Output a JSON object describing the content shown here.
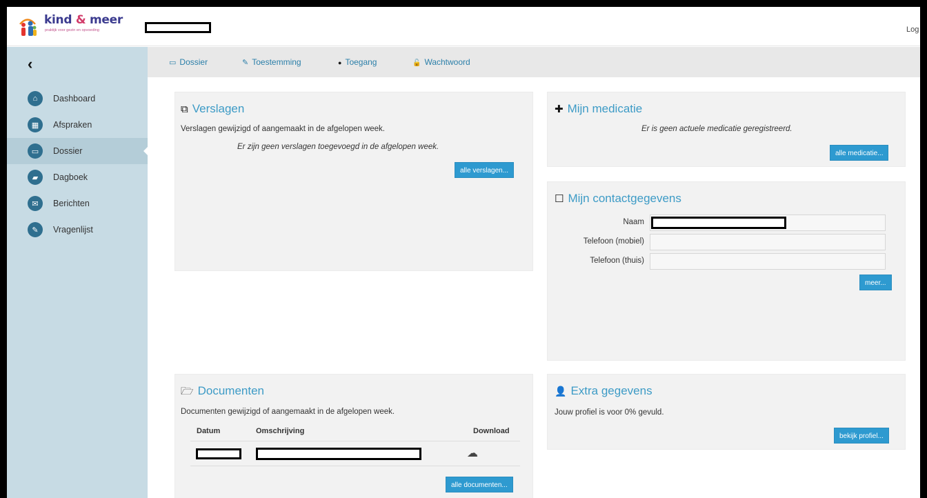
{
  "app": {
    "brand": "kind & meer",
    "brand_main": "kind ",
    "brand_amp": "&",
    "brand_end": " meer",
    "tagline": "praktijk voor gezin en opvoeding",
    "logout_label": "Log"
  },
  "sidebar": {
    "collapse_glyph": "‹",
    "items": [
      {
        "label": "Dashboard",
        "icon": "home-icon",
        "glyph": "⌂"
      },
      {
        "label": "Afspraken",
        "icon": "calendar-icon",
        "glyph": "▦"
      },
      {
        "label": "Dossier",
        "icon": "folder-open-icon",
        "glyph": "▭",
        "active": true
      },
      {
        "label": "Dagboek",
        "icon": "book-icon",
        "glyph": "▰"
      },
      {
        "label": "Berichten",
        "icon": "envelope-icon",
        "glyph": "✉"
      },
      {
        "label": "Vragenlijst",
        "icon": "edit-icon",
        "glyph": "✎"
      }
    ]
  },
  "tabs": [
    {
      "label": "Dossier",
      "icon": "folder-icon",
      "glyph": "▭"
    },
    {
      "label": "Toestemming",
      "icon": "edit-icon",
      "glyph": "✎"
    },
    {
      "label": "Toegang",
      "icon": "minus-circle-icon",
      "glyph": "●"
    },
    {
      "label": "Wachtwoord",
      "icon": "unlock-icon",
      "glyph": "🔓"
    }
  ],
  "verslagen": {
    "title": "Verslagen",
    "title_glyph": "⧉",
    "subtitle": "Verslagen gewijzigd of aangemaakt in de afgelopen week.",
    "empty": "Er zijn geen verslagen toegevoegd in de afgelopen week.",
    "button": "alle verslagen..."
  },
  "medicatie": {
    "title": "Mijn medicatie",
    "title_glyph": "✚",
    "empty": "Er is geen actuele medicatie geregistreerd.",
    "button": "alle medicatie..."
  },
  "contact": {
    "title": "Mijn contactgegevens",
    "title_glyph": "☐",
    "fields": [
      {
        "label": "Naam",
        "value": ""
      },
      {
        "label": "Telefoon (mobiel)",
        "value": ""
      },
      {
        "label": "Telefoon (thuis)",
        "value": ""
      }
    ],
    "button": "meer..."
  },
  "documenten": {
    "title": "Documenten",
    "title_glyph": "🗁",
    "subtitle": "Documenten gewijzigd of aangemaakt in de afgelopen week.",
    "columns": [
      "Datum",
      "Omschrijving",
      "Download"
    ],
    "download_icon": "cloud-download-icon",
    "download_glyph": "☁",
    "button": "alle documenten..."
  },
  "extra": {
    "title": "Extra gegevens",
    "title_glyph": "👤",
    "text": "Jouw profiel is voor 0% gevuld.",
    "button": "bekijk profiel..."
  },
  "colors": {
    "accent": "#3d9bc6",
    "button": "#2e9ad0",
    "sidebar": "#c7dbe4",
    "nav_icon": "#2f6f8f"
  }
}
